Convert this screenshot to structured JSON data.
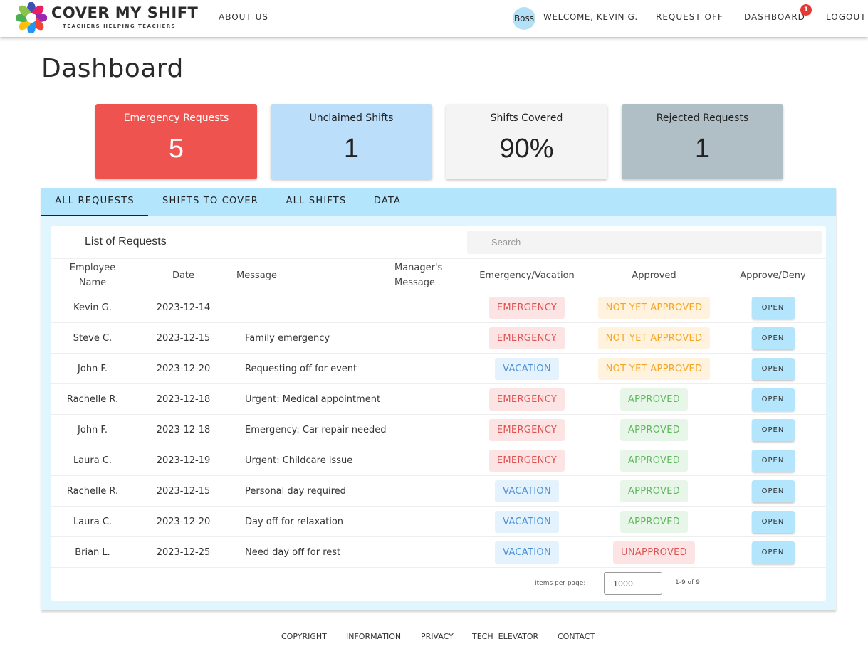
{
  "brand": {
    "title": "COVER MY SHIFT",
    "tagline": "TEACHERS HELPING TEACHERS"
  },
  "nav": {
    "about": "ABOUT US",
    "avatar": "Boss",
    "welcome": "WELCOME, KEVIN G.",
    "request_off": "REQUEST OFF",
    "dashboard": "DASHBOARD",
    "dashboard_badge": "1",
    "logout": "LOGOUT"
  },
  "page_title": "Dashboard",
  "stats": [
    {
      "label": "Emergency Requests",
      "value": "5",
      "color": "#ef5350"
    },
    {
      "label": "Unclaimed Shifts",
      "value": "1",
      "color": "#bbdefb"
    },
    {
      "label": "Shifts Covered",
      "value": "90%",
      "color": "#f4f4f4"
    },
    {
      "label": "Rejected Requests",
      "value": "1",
      "color": "#b0bec5"
    }
  ],
  "tabs": [
    {
      "label": "ALL REQUESTS",
      "active": true
    },
    {
      "label": "SHIFTS TO COVER",
      "active": false
    },
    {
      "label": "ALL SHIFTS",
      "active": false
    },
    {
      "label": "DATA",
      "active": false
    }
  ],
  "requests": {
    "title": "List of Requests",
    "search_placeholder": "Search",
    "columns": {
      "name_line1": "Employee",
      "name_line2": "Name",
      "date": "Date",
      "message": "Message",
      "mgr_line1": "Manager's",
      "mgr_line2": "Message",
      "type": "Emergency/Vacation",
      "approved": "Approved",
      "action": "Approve/Deny"
    },
    "rows": [
      {
        "name": "Kevin G.",
        "date": "2023-12-14",
        "message": "",
        "manager_message": "",
        "type": "EMERGENCY",
        "status": "NOT YET APPROVED",
        "action": "OPEN"
      },
      {
        "name": "Steve C.",
        "date": "2023-12-15",
        "message": "Family emergency",
        "manager_message": "",
        "type": "EMERGENCY",
        "status": "NOT YET APPROVED",
        "action": "OPEN"
      },
      {
        "name": "John F.",
        "date": "2023-12-20",
        "message": "Requesting off for event",
        "manager_message": "",
        "type": "VACATION",
        "status": "NOT YET APPROVED",
        "action": "OPEN"
      },
      {
        "name": "Rachelle R.",
        "date": "2023-12-18",
        "message": "Urgent: Medical appointment",
        "manager_message": "",
        "type": "EMERGENCY",
        "status": "APPROVED",
        "action": "OPEN"
      },
      {
        "name": "John F.",
        "date": "2023-12-18",
        "message": "Emergency: Car repair needed",
        "manager_message": "",
        "type": "EMERGENCY",
        "status": "APPROVED",
        "action": "OPEN"
      },
      {
        "name": "Laura C.",
        "date": "2023-12-19",
        "message": "Urgent: Childcare issue",
        "manager_message": "",
        "type": "EMERGENCY",
        "status": "APPROVED",
        "action": "OPEN"
      },
      {
        "name": "Rachelle R.",
        "date": "2023-12-15",
        "message": "Personal day required",
        "manager_message": "",
        "type": "VACATION",
        "status": "APPROVED",
        "action": "OPEN"
      },
      {
        "name": "Laura C.",
        "date": "2023-12-20",
        "message": "Day off for relaxation",
        "manager_message": "",
        "type": "VACATION",
        "status": "APPROVED",
        "action": "OPEN"
      },
      {
        "name": "Brian L.",
        "date": "2023-12-25",
        "message": "Need day off for rest",
        "manager_message": "",
        "type": "VACATION",
        "status": "UNAPPROVED",
        "action": "OPEN"
      }
    ],
    "pagination": {
      "items_per_page_label": "Items per page:",
      "items_per_page": "1000",
      "range": "1-9 of 9"
    }
  },
  "footer": [
    "COPYRIGHT",
    "INFORMATION",
    "PRIVACY",
    "TECH  ELEVATOR",
    "CONTACT"
  ]
}
